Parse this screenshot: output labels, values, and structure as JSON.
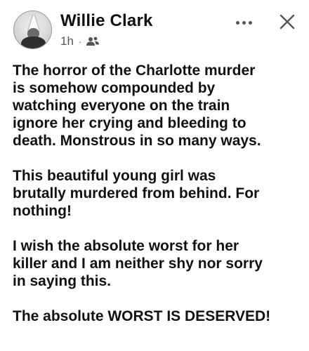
{
  "post": {
    "author": "Willie Clark",
    "time": "1h",
    "separator": "·",
    "audience_icon": "friends-icon",
    "menu_icon": "more-options-icon",
    "close_icon": "close-icon",
    "paragraphs": [
      "The horror of the Charlotte murder\nis somehow compounded by\nwatching everyone on the train\nignore her crying and bleeding to\ndeath. Monstrous in so many ways.",
      "This beautiful young girl was\nbrutally murdered from behind. For\nnothing!",
      "I wish the absolute worst for her\nkiller and I am neither shy nor sorry\nin saying this.",
      "The absolute WORST IS DESERVED!"
    ]
  }
}
